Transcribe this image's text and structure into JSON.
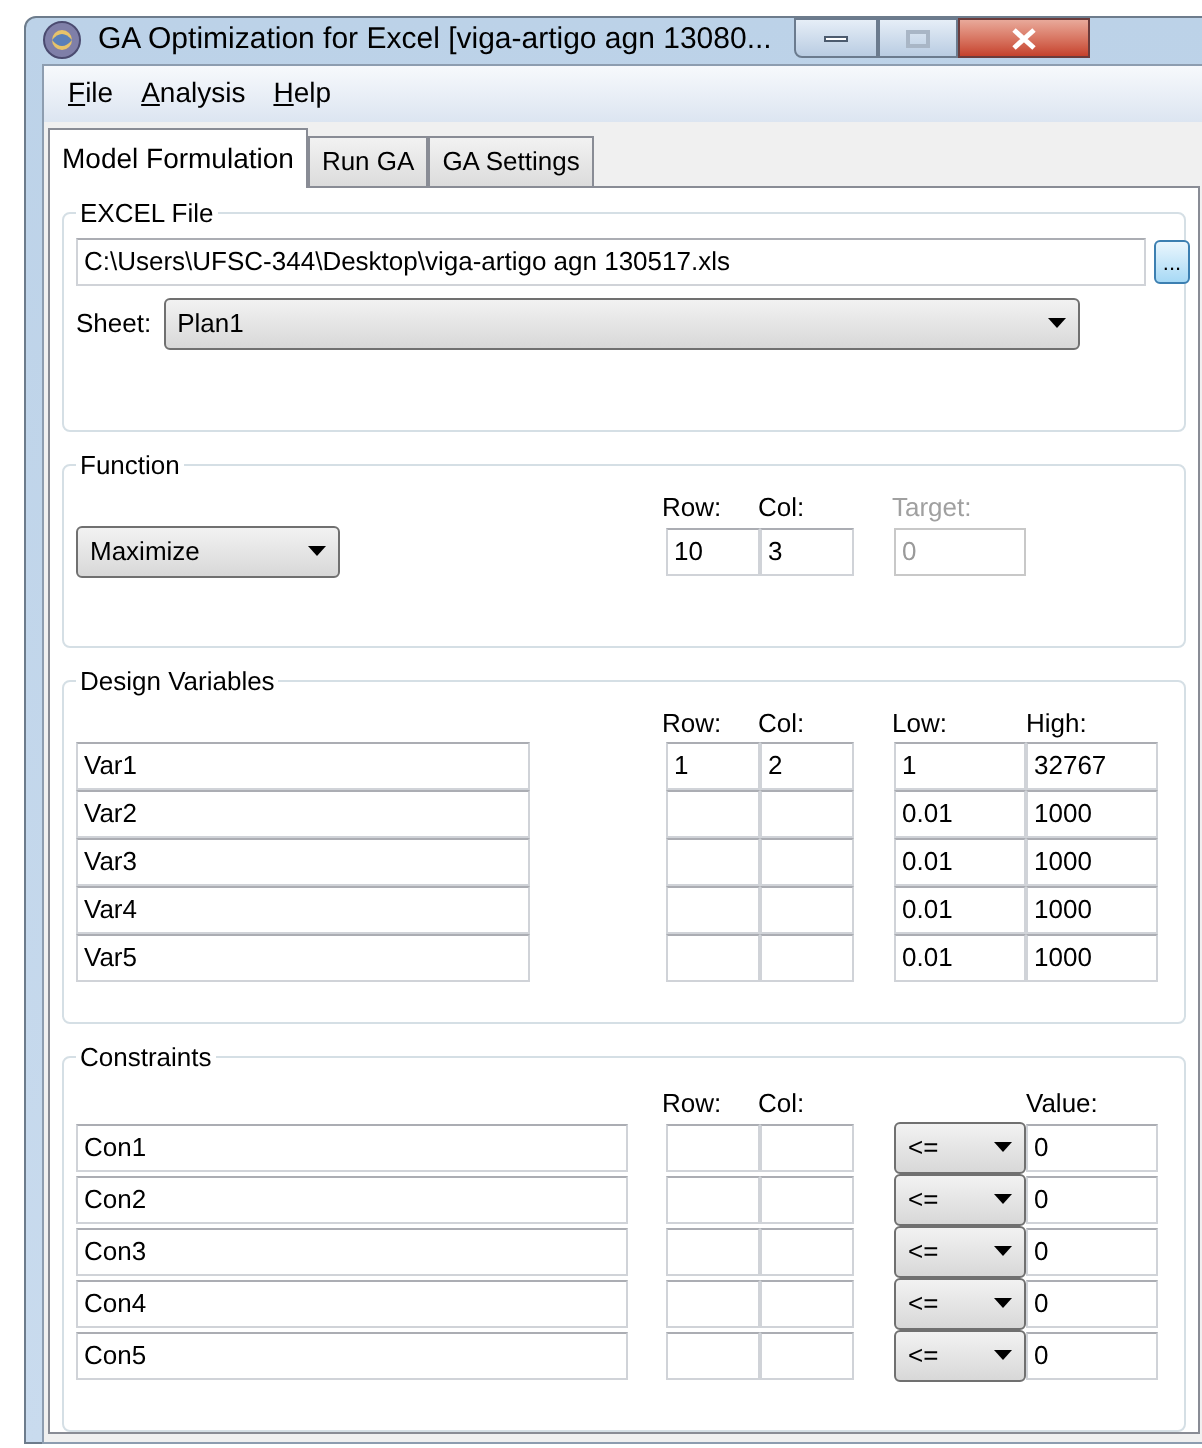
{
  "window": {
    "title": "GA Optimization for Excel [viga-artigo agn 13080..."
  },
  "menu": [
    "File",
    "Analysis",
    "Help"
  ],
  "tabs": [
    {
      "label": "Model Formulation",
      "selected": true
    },
    {
      "label": "Run GA",
      "selected": false
    },
    {
      "label": "GA Settings",
      "selected": false
    }
  ],
  "excel_file": {
    "group_title": "EXCEL File",
    "path": "C:\\Users\\UFSC-344\\Desktop\\viga-artigo agn 130517.xls",
    "browse_button": "...",
    "sheet_label": "Sheet:",
    "sheet": "Plan1"
  },
  "function": {
    "group_title": "Function",
    "mode": "Maximize",
    "row_label": "Row:",
    "col_label": "Col:",
    "target_label": "Target:",
    "row": "10",
    "col": "3",
    "target": "0",
    "target_disabled": true
  },
  "design_variables": {
    "group_title": "Design Variables",
    "row_label": "Row:",
    "col_label": "Col:",
    "low_label": "Low:",
    "high_label": "High:",
    "rows": [
      {
        "name": "Var1",
        "row": "1",
        "col": "2",
        "low": "1",
        "high": "32767"
      },
      {
        "name": "Var2",
        "low": "0.01",
        "high": "1000"
      },
      {
        "name": "Var3",
        "low": "0.01",
        "high": "1000"
      },
      {
        "name": "Var4",
        "low": "0.01",
        "high": "1000"
      },
      {
        "name": "Var5",
        "low": "0.01",
        "high": "1000"
      }
    ]
  },
  "constraints": {
    "group_title": "Constraints",
    "row_label": "Row:",
    "col_label": "Col:",
    "value_label": "Value:",
    "rows": [
      {
        "name": "Con1",
        "operator": "<=",
        "value": "0"
      },
      {
        "name": "Con2",
        "operator": "<=",
        "value": "0"
      },
      {
        "name": "Con3",
        "operator": "<=",
        "value": "0"
      },
      {
        "name": "Con4",
        "operator": "<=",
        "value": "0"
      },
      {
        "name": "Con5",
        "operator": "<=",
        "value": "0"
      }
    ]
  }
}
